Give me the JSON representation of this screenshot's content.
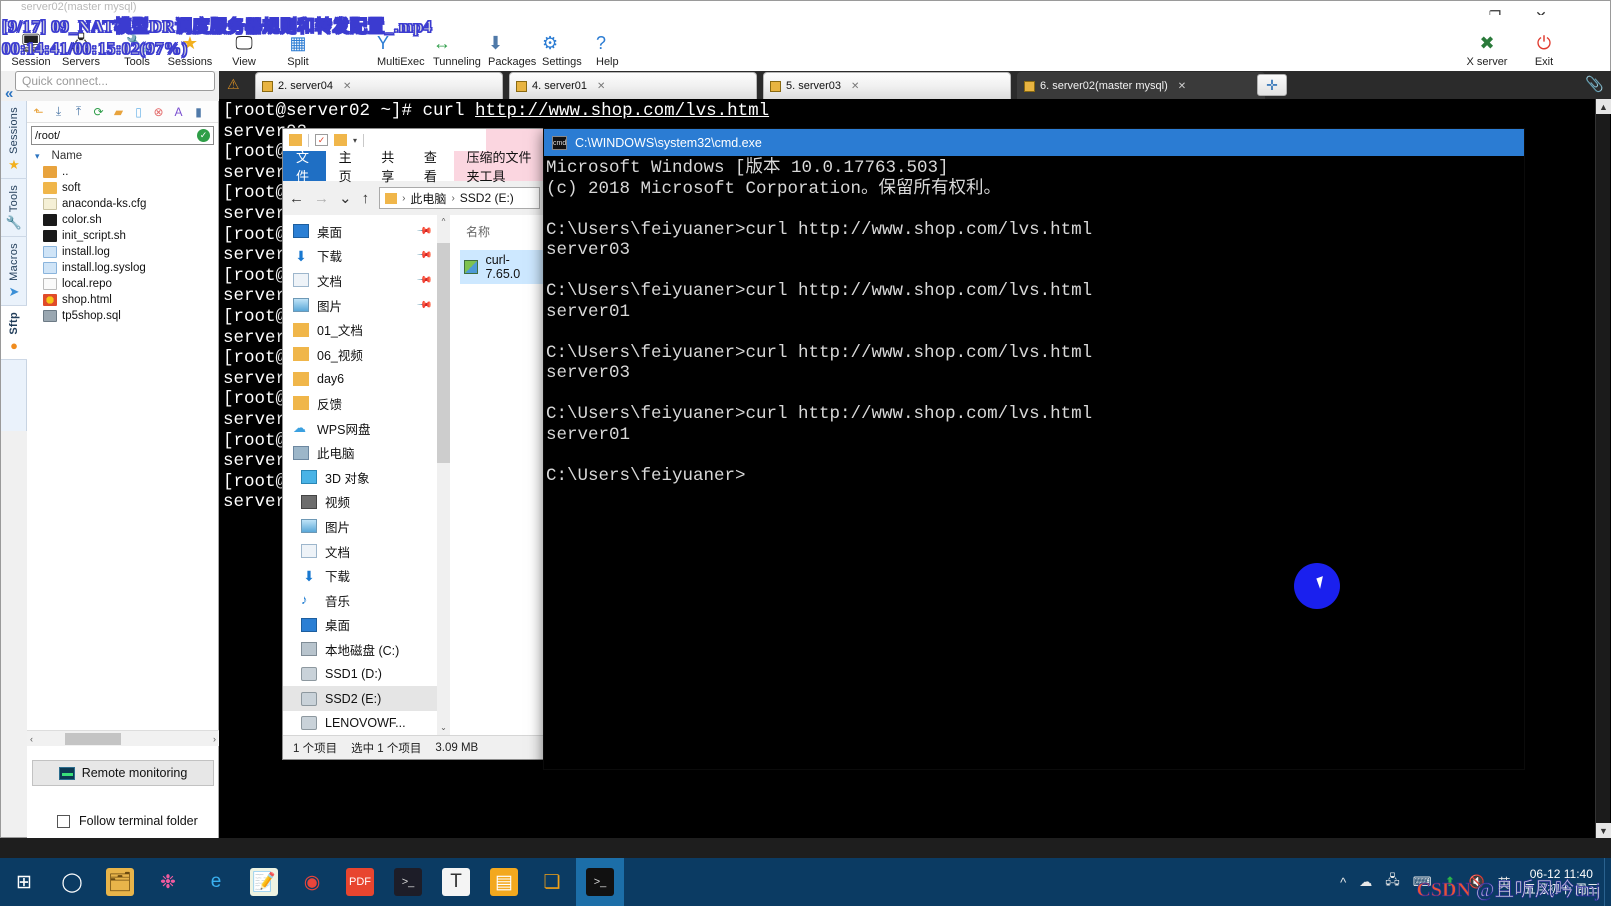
{
  "player_osd": {
    "title": "[9/17] 09_NAT模型DR调度服务器规则和转发配置_.mp4",
    "time": "00:14:41/00:15:02(97%)",
    "bg_title": "server02(master mysql)"
  },
  "crt": {
    "window_controls": {
      "minimize": "—",
      "maximize": "❐",
      "close": "✕"
    },
    "toolbar": [
      {
        "label": "Session",
        "icon": "session-icon",
        "glyph": "🖥"
      },
      {
        "label": "Servers",
        "icon": "servers-icon",
        "glyph": "🖧"
      },
      {
        "label": "Tools",
        "icon": "tools-icon",
        "glyph": "🔧"
      },
      {
        "label": "Sessions",
        "icon": "sessions-star-icon",
        "glyph": "★"
      },
      {
        "label": "View",
        "icon": "view-icon",
        "glyph": "🖵"
      },
      {
        "label": "Split",
        "icon": "split-icon",
        "glyph": "▦"
      },
      {
        "label": "MultiExec",
        "icon": "multiexec-icon",
        "glyph": "Y"
      },
      {
        "label": "Tunneling",
        "icon": "tunneling-icon",
        "glyph": "↔"
      },
      {
        "label": "Packages",
        "icon": "packages-icon",
        "glyph": "⬇"
      },
      {
        "label": "Settings",
        "icon": "settings-icon",
        "glyph": "⚙"
      },
      {
        "label": "Help",
        "icon": "help-icon",
        "glyph": "?"
      },
      {
        "label": "X server",
        "icon": "xserver-icon",
        "glyph": "✖"
      },
      {
        "label": "Exit",
        "icon": "exit-power-icon",
        "glyph": "⏻"
      }
    ],
    "quick_connect_placeholder": "Quick connect...",
    "vertical_tabs": [
      {
        "label": "Sessions",
        "icon": "star-icon",
        "glyph": "★"
      },
      {
        "label": "Tools",
        "icon": "wrench-icon",
        "glyph": "🔧"
      },
      {
        "label": "Macros",
        "icon": "paper-plane-icon",
        "glyph": "➤"
      },
      {
        "label": "Sftp",
        "icon": "globe-icon",
        "glyph": "●"
      }
    ],
    "collapse_glyph": "«",
    "attach_glyph": "📎"
  },
  "sftp": {
    "toolbar_icons": [
      "up-folder-icon",
      "download-icon",
      "upload-icon",
      "refresh-icon",
      "new-folder-icon",
      "new-file-icon",
      "delete-icon",
      "rename-icon",
      "more-icon"
    ],
    "path": "/root/",
    "path_ok_glyph": "✓",
    "column_header": "Name",
    "sort_caret": "▾",
    "files": [
      {
        "name": "..",
        "icon": "parent-folder-icon",
        "cls": "i-up"
      },
      {
        "name": "soft",
        "icon": "folder-icon",
        "cls": "i-folder"
      },
      {
        "name": "anaconda-ks.cfg",
        "icon": "config-file-icon",
        "cls": "i-cfg"
      },
      {
        "name": "color.sh",
        "icon": "shell-script-icon",
        "cls": "i-sh"
      },
      {
        "name": "init_script.sh",
        "icon": "shell-script-icon",
        "cls": "i-sh"
      },
      {
        "name": "install.log",
        "icon": "log-file-icon",
        "cls": "i-log"
      },
      {
        "name": "install.log.syslog",
        "icon": "log-file-icon",
        "cls": "i-log"
      },
      {
        "name": "local.repo",
        "icon": "text-file-icon",
        "cls": "i-repo"
      },
      {
        "name": "shop.html",
        "icon": "html-file-icon",
        "cls": "i-html"
      },
      {
        "name": "tp5shop.sql",
        "icon": "sql-file-icon",
        "cls": "i-sql"
      }
    ],
    "scroll_left_glyph": "‹",
    "scroll_right_glyph": "›",
    "remote_monitoring": "Remote monitoring",
    "follow_terminal_folder": "Follow terminal folder"
  },
  "tabs": {
    "warn_glyph": "⚠",
    "plus_glyph": "✛",
    "close_glyph": "✕",
    "items": [
      {
        "label": "2. server04",
        "active": false
      },
      {
        "label": "4. server01",
        "active": false
      },
      {
        "label": "5. server03",
        "active": false
      },
      {
        "label": "6. server02(master mysql)",
        "active": true
      }
    ]
  },
  "terminal": {
    "prompt": "[root@server02 ~]# ",
    "command": "curl ",
    "url": "http://www.shop.com/lvs.html",
    "responses": [
      "server02",
      "server02",
      "server02",
      "server02",
      "server02",
      "server02",
      "server02",
      "server02",
      "server02",
      "server02"
    ],
    "lines_visible": 20,
    "scroll_up_glyph": "▲",
    "scroll_down_glyph": "▼"
  },
  "explorer": {
    "qat_dropdown_glyph": "▾",
    "ribbon_tabs": [
      "文件",
      "主页",
      "共享",
      "查看",
      "压缩的文件夹工具"
    ],
    "nav": {
      "back": "←",
      "forward": "→",
      "recent": "⌄",
      "up": "↑"
    },
    "breadcrumb": [
      "此电脑",
      "SSD2 (E:)"
    ],
    "breadcrumb_sep": "›",
    "tree": [
      {
        "label": "桌面",
        "icon": "desktop-icon",
        "cls": "t-desktop",
        "pinned": true,
        "indent": false,
        "selected": false
      },
      {
        "label": "下载",
        "icon": "downloads-icon",
        "cls": "t-down",
        "pinned": true,
        "indent": false,
        "selected": false,
        "glyph": "⬇"
      },
      {
        "label": "文档",
        "icon": "documents-icon",
        "cls": "t-doc",
        "pinned": true,
        "indent": false,
        "selected": false
      },
      {
        "label": "图片",
        "icon": "pictures-icon",
        "cls": "t-pic",
        "pinned": true,
        "indent": false,
        "selected": false
      },
      {
        "label": "01_文档",
        "icon": "folder-icon",
        "cls": "t-folder",
        "pinned": false,
        "indent": false,
        "selected": false
      },
      {
        "label": "06_视频",
        "icon": "folder-icon",
        "cls": "t-folder",
        "pinned": false,
        "indent": false,
        "selected": false
      },
      {
        "label": "day6",
        "icon": "folder-icon",
        "cls": "t-folder",
        "pinned": false,
        "indent": false,
        "selected": false
      },
      {
        "label": "反馈",
        "icon": "folder-icon",
        "cls": "t-folder",
        "pinned": false,
        "indent": false,
        "selected": false
      },
      {
        "label": "WPS网盘",
        "icon": "cloud-icon",
        "cls": "t-cloud",
        "pinned": false,
        "indent": false,
        "selected": false,
        "glyph": "☁"
      },
      {
        "label": "此电脑",
        "icon": "this-pc-icon",
        "cls": "t-pc",
        "pinned": false,
        "indent": false,
        "selected": false
      },
      {
        "label": "3D 对象",
        "icon": "3d-objects-icon",
        "cls": "t-3d",
        "pinned": false,
        "indent": true,
        "selected": false
      },
      {
        "label": "视频",
        "icon": "videos-icon",
        "cls": "t-vid",
        "pinned": false,
        "indent": true,
        "selected": false
      },
      {
        "label": "图片",
        "icon": "pictures-icon",
        "cls": "t-pic",
        "pinned": false,
        "indent": true,
        "selected": false
      },
      {
        "label": "文档",
        "icon": "documents-icon",
        "cls": "t-doc",
        "pinned": false,
        "indent": true,
        "selected": false
      },
      {
        "label": "下载",
        "icon": "downloads-icon",
        "cls": "t-down",
        "pinned": false,
        "indent": true,
        "selected": false,
        "glyph": "⬇"
      },
      {
        "label": "音乐",
        "icon": "music-icon",
        "cls": "t-music",
        "pinned": false,
        "indent": true,
        "selected": false,
        "glyph": "♪"
      },
      {
        "label": "桌面",
        "icon": "desktop-icon",
        "cls": "t-desktop",
        "pinned": false,
        "indent": true,
        "selected": false
      },
      {
        "label": "本地磁盘 (C:)",
        "icon": "hard-disk-icon",
        "cls": "t-hdd",
        "pinned": false,
        "indent": true,
        "selected": false
      },
      {
        "label": "SSD1 (D:)",
        "icon": "drive-icon",
        "cls": "t-drive",
        "pinned": false,
        "indent": true,
        "selected": false
      },
      {
        "label": "SSD2 (E:)",
        "icon": "drive-icon",
        "cls": "t-drive",
        "pinned": false,
        "indent": true,
        "selected": true
      },
      {
        "label": "LENOVOWF...",
        "icon": "drive-icon",
        "cls": "t-drive",
        "pinned": false,
        "indent": true,
        "selected": false
      }
    ],
    "list_column": "名称",
    "items": [
      {
        "name": "curl-7.65.0",
        "icon": "zip-archive-icon"
      }
    ],
    "status": {
      "count": "1 个项目",
      "selected": "选中 1 个项目",
      "size": "3.09 MB"
    }
  },
  "cmd": {
    "title": "C:\\WINDOWS\\system32\\cmd.exe",
    "icon_label": "cmd",
    "lines": [
      "Microsoft Windows [版本 10.0.17763.503]",
      "(c) 2018 Microsoft Corporation。保留所有权利。",
      "",
      "C:\\Users\\feiyuaner>curl http://www.shop.com/lvs.html",
      "server03",
      "",
      "C:\\Users\\feiyuaner>curl http://www.shop.com/lvs.html",
      "server01",
      "",
      "C:\\Users\\feiyuaner>curl http://www.shop.com/lvs.html",
      "server03",
      "",
      "C:\\Users\\feiyuaner>curl http://www.shop.com/lvs.html",
      "server01",
      "",
      "C:\\Users\\feiyuaner>"
    ]
  },
  "taskbar": {
    "items": [
      {
        "name": "start-button",
        "glyph": "⊞",
        "bg": "transparent",
        "color": "#ffffff",
        "active": false
      },
      {
        "name": "cortana-search",
        "glyph": "◯",
        "bg": "transparent",
        "color": "#ffffff",
        "active": false
      },
      {
        "name": "file-explorer",
        "glyph": "🗂",
        "bg": "#e8b44a",
        "color": "#6b4a10",
        "active": false
      },
      {
        "name": "photos-app",
        "glyph": "❉",
        "bg": "transparent",
        "color": "#f05a9e",
        "active": false
      },
      {
        "name": "edge-browser",
        "glyph": "e",
        "bg": "transparent",
        "color": "#3ab0f0",
        "active": false
      },
      {
        "name": "notes-app",
        "glyph": "📝",
        "bg": "#eef3e2",
        "color": "#3b7a2a",
        "active": false
      },
      {
        "name": "chrome-browser",
        "glyph": "◉",
        "bg": "transparent",
        "color": "#e9453b",
        "active": false
      },
      {
        "name": "pdf-reader",
        "glyph": "PDF",
        "bg": "#e8452f",
        "color": "#ffffff",
        "active": false
      },
      {
        "name": "securecrt-app",
        "glyph": ">_",
        "bg": "#1d1d28",
        "color": "#d8d8d8",
        "active": false
      },
      {
        "name": "typora-app",
        "glyph": "T",
        "bg": "#f4f4f4",
        "color": "#333333",
        "active": false
      },
      {
        "name": "wps-note",
        "glyph": "▤",
        "bg": "#f3a81e",
        "color": "#ffffff",
        "active": false
      },
      {
        "name": "vmware-workstation",
        "glyph": "❏",
        "bg": "transparent",
        "color": "#f0a018",
        "active": false
      },
      {
        "name": "command-prompt",
        "glyph": ">_",
        "bg": "#111111",
        "color": "#d8d8d8",
        "active": true
      }
    ],
    "tray": [
      "^",
      "☁",
      "🖧",
      "⌨",
      "⬆",
      "🔇",
      "英"
    ],
    "clock_time": "06-12 11:40",
    "clock_date": "五月初十 周三",
    "watermark_csdn": "CSDN",
    "watermark_user": "@且听风吟tmj"
  }
}
